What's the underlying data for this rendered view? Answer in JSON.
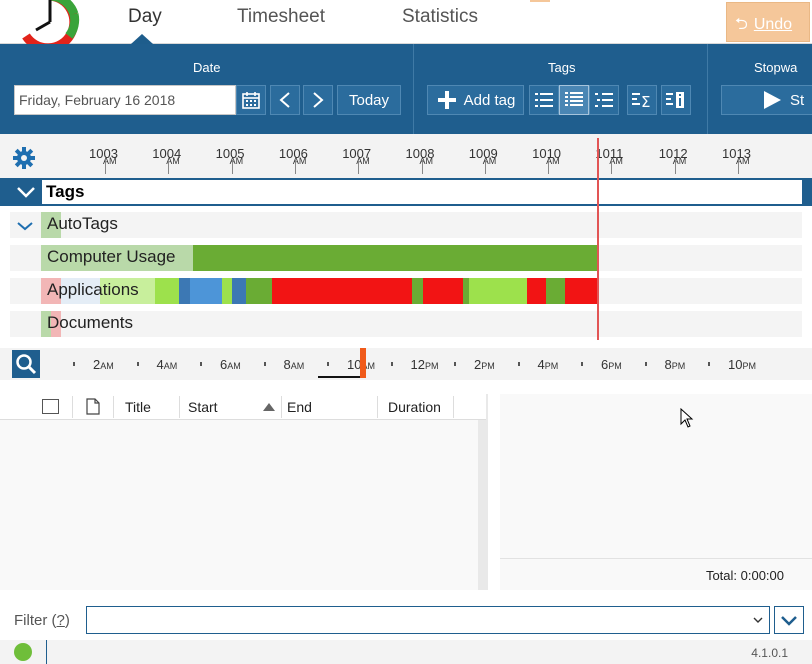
{
  "tabs": [
    {
      "label": "Day",
      "active": true
    },
    {
      "label": "Timesheet",
      "active": false
    },
    {
      "label": "Statistics",
      "active": false
    }
  ],
  "undo_label": "Undo",
  "ribbon": {
    "date_group_label": "Date",
    "date_value": "Friday, February 16 2018",
    "today_label": "Today",
    "tags_group_label": "Tags",
    "add_tag_label": "Add tag",
    "stopwatch_group_label": "Stopwa",
    "stopwatch_start_label": "St"
  },
  "ruler_hours": [
    "10",
    "10",
    "10",
    "10",
    "10",
    "10",
    "10",
    "10",
    "10",
    "10",
    "10"
  ],
  "ruler_minutes": [
    "03",
    "04",
    "05",
    "06",
    "07",
    "08",
    "09",
    "10",
    "11",
    "12",
    "13"
  ],
  "ruler_suffix": "AM",
  "tags_header": "Tags",
  "tag_rows": [
    {
      "label": "AutoTags"
    },
    {
      "label": "Computer Usage"
    },
    {
      "label": "Applications"
    },
    {
      "label": "Documents"
    }
  ],
  "overview_labels": [
    {
      "num": "2",
      "suffix": "AM"
    },
    {
      "num": "4",
      "suffix": "AM"
    },
    {
      "num": "6",
      "suffix": "AM"
    },
    {
      "num": "8",
      "suffix": "AM"
    },
    {
      "num": "10",
      "suffix": "AM"
    },
    {
      "num": "12",
      "suffix": "PM"
    },
    {
      "num": "2",
      "suffix": "PM"
    },
    {
      "num": "4",
      "suffix": "PM"
    },
    {
      "num": "6",
      "suffix": "PM"
    },
    {
      "num": "8",
      "suffix": "PM"
    },
    {
      "num": "10",
      "suffix": "PM"
    }
  ],
  "table": {
    "columns": [
      "Title",
      "Start",
      "End",
      "Duration"
    ]
  },
  "total_label": "Total: 0:00:00",
  "filter_label": "Filter",
  "filter_help": "?",
  "version": "4.1.0.1",
  "colors": {
    "ribbon": "#1f5e8e",
    "green": "#6aac34",
    "lightgreen": "#9de14c",
    "red": "#f21414",
    "blue": "#3c78b4",
    "now_line": "#e25555"
  }
}
